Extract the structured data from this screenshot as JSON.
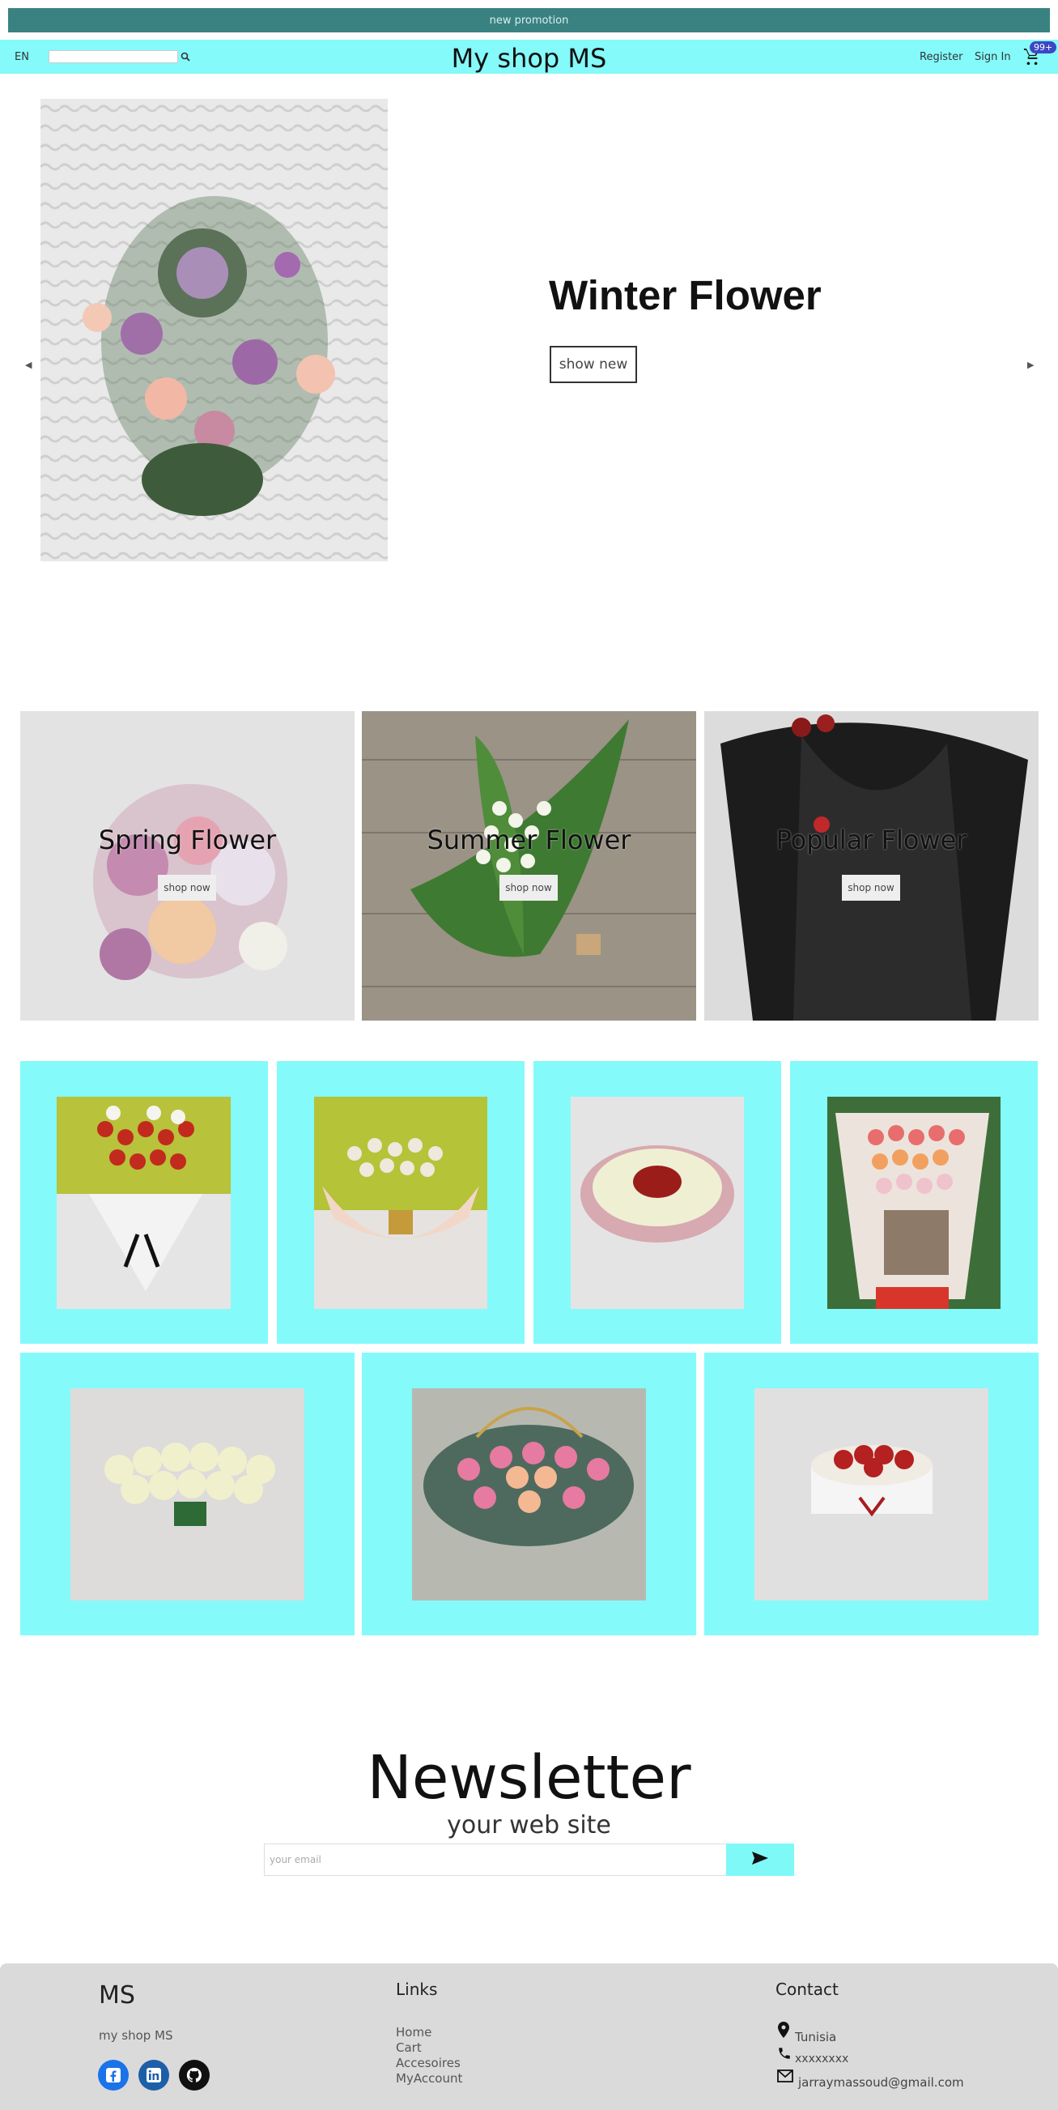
{
  "promo": {
    "text": "new promotion"
  },
  "header": {
    "lang": "EN",
    "search_placeholder": "",
    "brand": "My shop MS",
    "register": "Register",
    "signin": "Sign In",
    "cart_badge": "99+"
  },
  "hero": {
    "title": "Winter Flower",
    "button": "show new"
  },
  "categories": [
    {
      "title": "Spring Flower",
      "button": "shop now"
    },
    {
      "title": "Summer Flower",
      "button": "shop now"
    },
    {
      "title": "Popular Flower",
      "button": "shop now"
    }
  ],
  "newsletter": {
    "title": "Newsletter",
    "subtitle": "your web site",
    "placeholder": "your email"
  },
  "footer": {
    "brand": "MS",
    "tagline": "my shop MS",
    "links_title": "Links",
    "links": [
      "Home",
      "Cart",
      "Accesoires",
      "MyAccount"
    ],
    "contact_title": "Contact",
    "location": "Tunisia",
    "phone": "xxxxxxxx",
    "email": "jarraymassoud@gmail.com"
  },
  "colors": {
    "accent": "#84fafa",
    "promo": "#3a8282",
    "badge": "#3b47c4"
  }
}
